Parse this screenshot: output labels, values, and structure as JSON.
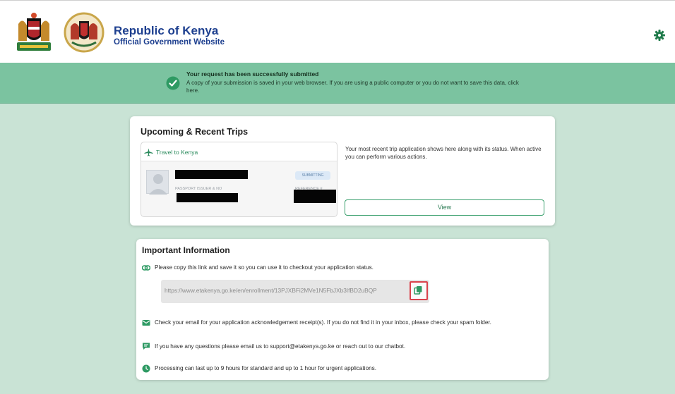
{
  "header": {
    "title": "Republic of Kenya",
    "subtitle": "Official Government Website",
    "crest_icons": [
      "kenya-coat-of-arms",
      "seal-emblem"
    ],
    "settings_icon": "gear-icon"
  },
  "banner": {
    "title": "Your request has been successfully submitted",
    "text": "A copy of your submission is saved in your web browser. If you are using a public computer or you do not want to save this data, click here.",
    "icon": "check-circle-icon",
    "color": "#7bc3a0"
  },
  "trips": {
    "title": "Upcoming & Recent Trips",
    "trip_name": "Travel to Kenya",
    "status": "SUBMITTING",
    "passport_label": "PASSPORT ISSUER & NO",
    "reference_label": "REFERENCE #",
    "description": "Your most recent trip application shows here along with its status. When active you can perform various actions.",
    "view_label": "View"
  },
  "info": {
    "title": "Important Information",
    "link_text": "Please copy this link and save it so you can use it to checkout your application status.",
    "url": "https://www.etakenya.go.ke/en/enrollment/13PJXBFi2MVe1N5FbJXb3IfBD2uBQP",
    "email_text": "Check your email for your application acknowledgement receipt(s). If you do not find it in your inbox, please check your spam folder.",
    "chat_text": "If you have any questions please email us to support@etakenya.go.ke or reach out to our chatbot.",
    "time_text": "Processing can last up to 9 hours for standard and up to 1 hour for urgent applications."
  },
  "colors": {
    "brand_blue": "#1d3f8f",
    "accent_green": "#2a8a5c",
    "page_bg": "#c9e3d5",
    "highlight_red": "#d9434c"
  }
}
